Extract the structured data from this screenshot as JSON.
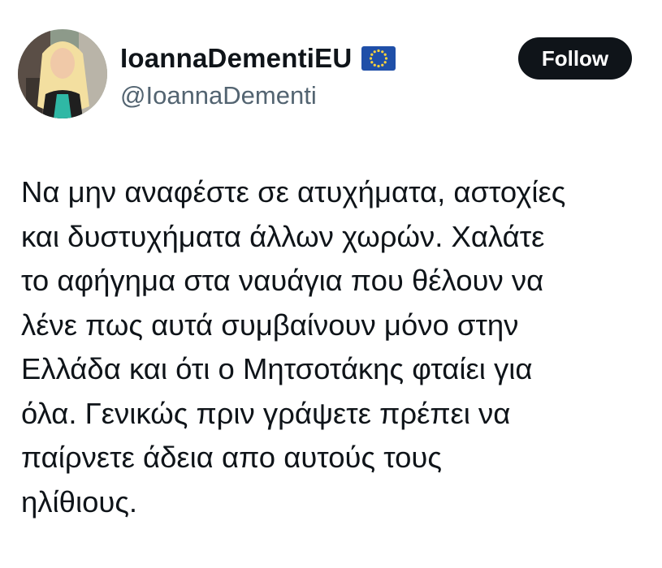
{
  "author": {
    "display_name": "IoannaDementiEU",
    "handle": "@IoannaDementi",
    "badge_icon": "eu-flag-icon",
    "avatar": "profile-photo"
  },
  "follow_button": {
    "label": "Follow"
  },
  "tweet": {
    "lines": [
      "Να μην αναφέστε σε ατυχήματα, αστοχίες",
      "και δυστυχήματα άλλων χωρών. Χαλάτε",
      "το αφήγημα στα ναυάγια που θέλουν να",
      "λένε πως αυτά συμβαίνουν μόνο στην",
      "Ελλάδα και ότι ο Μητσοτάκης φταίει για",
      "όλα. Γενικώς πριν γράψετε πρέπει να",
      "παίρνετε άδεια απο αυτούς τους",
      "ηλίθιους."
    ]
  },
  "colors": {
    "text_primary": "#0f1419",
    "text_secondary": "#536471",
    "button_bg": "#0f1419",
    "button_text": "#ffffff",
    "flag_blue": "#1f4fa8",
    "flag_star": "#ffd43b"
  }
}
